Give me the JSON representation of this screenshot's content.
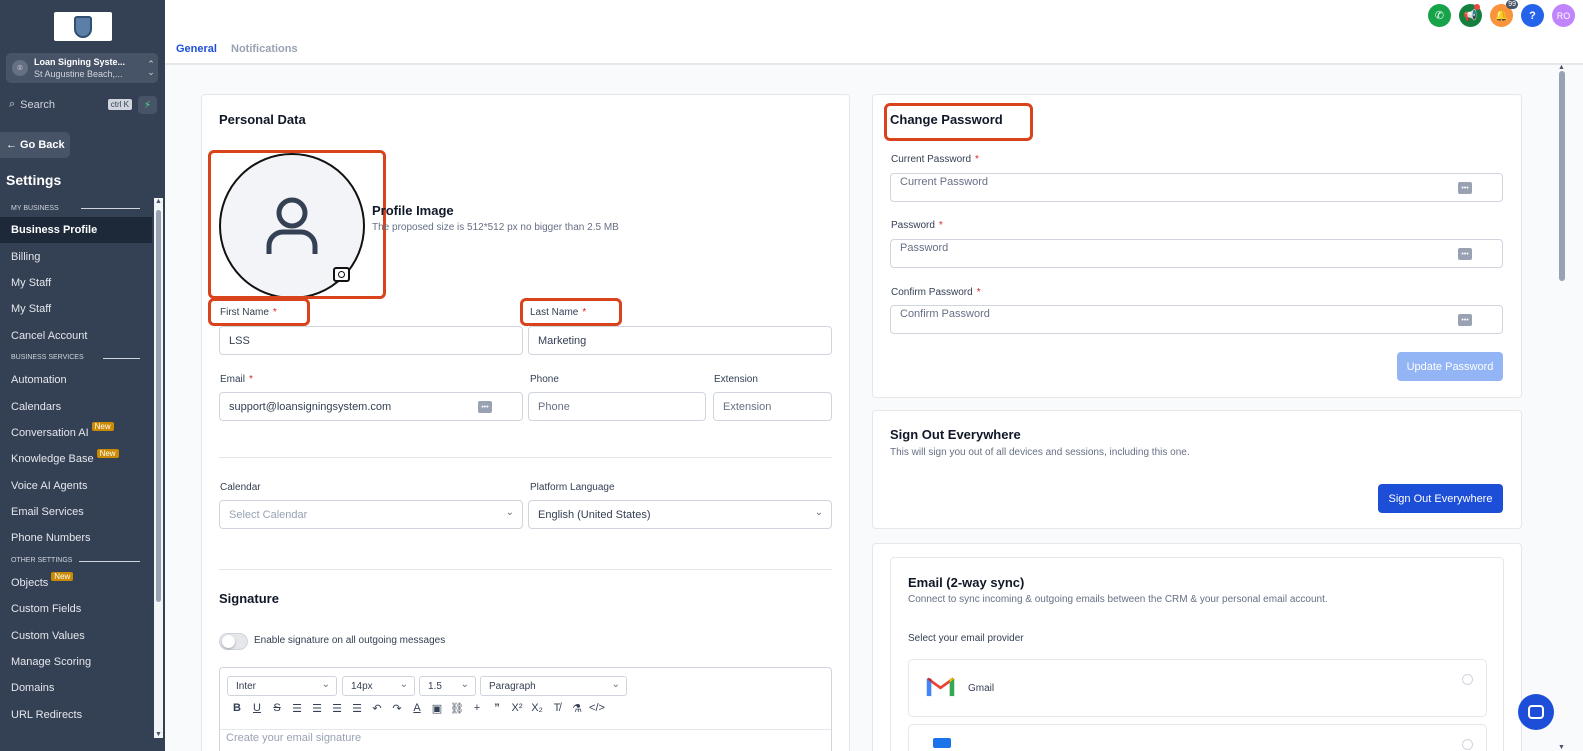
{
  "sidebar": {
    "account_name": "Loan Signing Syste...",
    "account_location": "St Augustine Beach,...",
    "search_placeholder": "Search",
    "search_shortcut": "ctrl K",
    "go_back": "Go Back",
    "title": "Settings",
    "sections": [
      {
        "label": "MY BUSINESS",
        "items": [
          {
            "label": "Business Profile",
            "active": true
          },
          {
            "label": "Billing"
          },
          {
            "label": "My Staff"
          },
          {
            "label": "My Staff"
          },
          {
            "label": "Cancel Account"
          }
        ]
      },
      {
        "label": "BUSINESS SERVICES",
        "items": [
          {
            "label": "Automation"
          },
          {
            "label": "Calendars"
          },
          {
            "label": "Conversation AI",
            "badge": "New"
          },
          {
            "label": "Knowledge Base",
            "badge": "New"
          },
          {
            "label": "Voice AI Agents"
          },
          {
            "label": "Email Services"
          },
          {
            "label": "Phone Numbers"
          }
        ]
      },
      {
        "label": "OTHER SETTINGS",
        "items": [
          {
            "label": "Objects",
            "badge": "New"
          },
          {
            "label": "Custom Fields"
          },
          {
            "label": "Custom Values"
          },
          {
            "label": "Manage Scoring"
          },
          {
            "label": "Domains"
          },
          {
            "label": "URL Redirects"
          }
        ]
      }
    ]
  },
  "topbar": {
    "tabs": {
      "general": "General",
      "notifications": "Notifications"
    },
    "notification_count": "99",
    "help": "?",
    "avatar_initials": "RO"
  },
  "personal": {
    "title": "Personal Data",
    "profile_image_title": "Profile Image",
    "profile_image_hint": "The proposed size is 512*512 px no bigger than 2.5 MB",
    "first_name_label": "First Name",
    "first_name_value": "LSS",
    "last_name_label": "Last Name",
    "last_name_value": "Marketing",
    "email_label": "Email",
    "email_value": "support@loansigningsystem.com",
    "phone_label": "Phone",
    "phone_placeholder": "Phone",
    "extension_label": "Extension",
    "extension_placeholder": "Extension",
    "calendar_label": "Calendar",
    "calendar_placeholder": "Select Calendar",
    "language_label": "Platform Language",
    "language_value": "English (United States)",
    "signature_title": "Signature",
    "signature_toggle_label": "Enable signature on all outgoing messages",
    "editor": {
      "font": "Inter",
      "size": "14px",
      "line_height": "1.5",
      "block": "Paragraph",
      "placeholder": "Create your email signature"
    },
    "required_mark": "*"
  },
  "password": {
    "title": "Change Password",
    "current_label": "Current Password",
    "current_placeholder": "Current Password",
    "new_label": "Password",
    "new_placeholder": "Password",
    "confirm_label": "Confirm Password",
    "confirm_placeholder": "Confirm Password",
    "update_button": "Update Password"
  },
  "signout": {
    "title": "Sign Out Everywhere",
    "desc": "This will sign you out of all devices and sessions, including this one.",
    "button": "Sign Out Everywhere"
  },
  "email_sync": {
    "title": "Email (2-way sync)",
    "desc": "Connect to sync incoming & outgoing emails between the CRM & your personal email account.",
    "select_label": "Select your email provider",
    "providers": [
      "Gmail"
    ]
  }
}
